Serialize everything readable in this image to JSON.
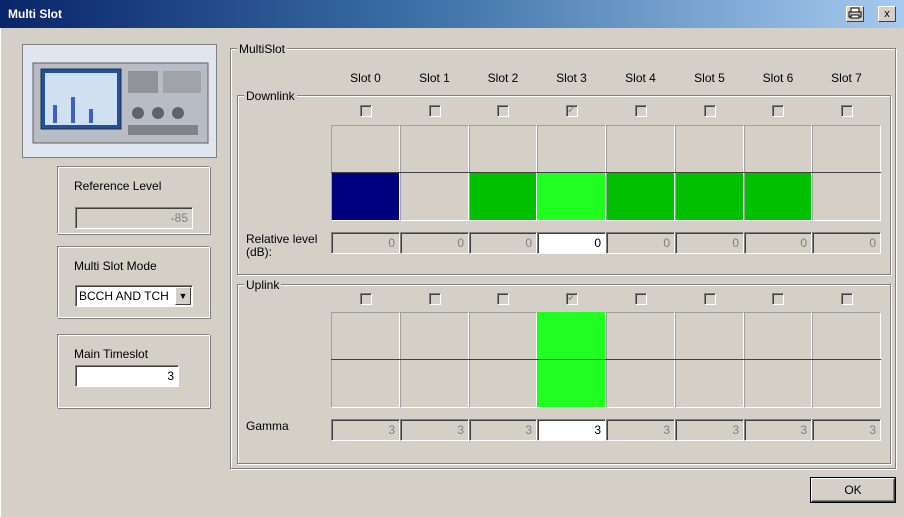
{
  "window": {
    "title": "Multi Slot",
    "print_icon": "printer-icon",
    "close_label": "x"
  },
  "left_panel": {
    "reference_level": {
      "label": "Reference Level",
      "value": "-85"
    },
    "multi_slot_mode": {
      "label": "Multi Slot Mode",
      "value": "BCCH AND TCH"
    },
    "main_timeslot": {
      "label": "Main Timeslot",
      "value": "3"
    }
  },
  "multislot": {
    "group_label": "MultiSlot",
    "slots": [
      "Slot 0",
      "Slot 1",
      "Slot 2",
      "Slot 3",
      "Slot 4",
      "Slot 5",
      "Slot 6",
      "Slot 7"
    ],
    "downlink": {
      "label": "Downlink",
      "checked": [
        false,
        false,
        false,
        true,
        false,
        false,
        false,
        false
      ],
      "bar_colors": [
        "#000080",
        "",
        "#00c000",
        "#20ff20",
        "#00c000",
        "#00c000",
        "#00c000",
        ""
      ],
      "row_label_1": "Relative level",
      "row_label_2": "(dB):",
      "values": [
        "0",
        "0",
        "0",
        "0",
        "0",
        "0",
        "0",
        "0"
      ]
    },
    "uplink": {
      "label": "Uplink",
      "checked": [
        false,
        false,
        false,
        true,
        false,
        false,
        false,
        false
      ],
      "bar_colors": [
        "",
        "",
        "",
        "#20ff20",
        "",
        "",
        "",
        ""
      ],
      "row_label": "Gamma",
      "values": [
        "3",
        "3",
        "3",
        "3",
        "3",
        "3",
        "3",
        "3"
      ]
    },
    "active_slot": 3
  },
  "buttons": {
    "ok": "OK"
  },
  "colors": {
    "face": "#d4d0c8",
    "title_start": "#0a246a",
    "title_end": "#a6caf0"
  }
}
